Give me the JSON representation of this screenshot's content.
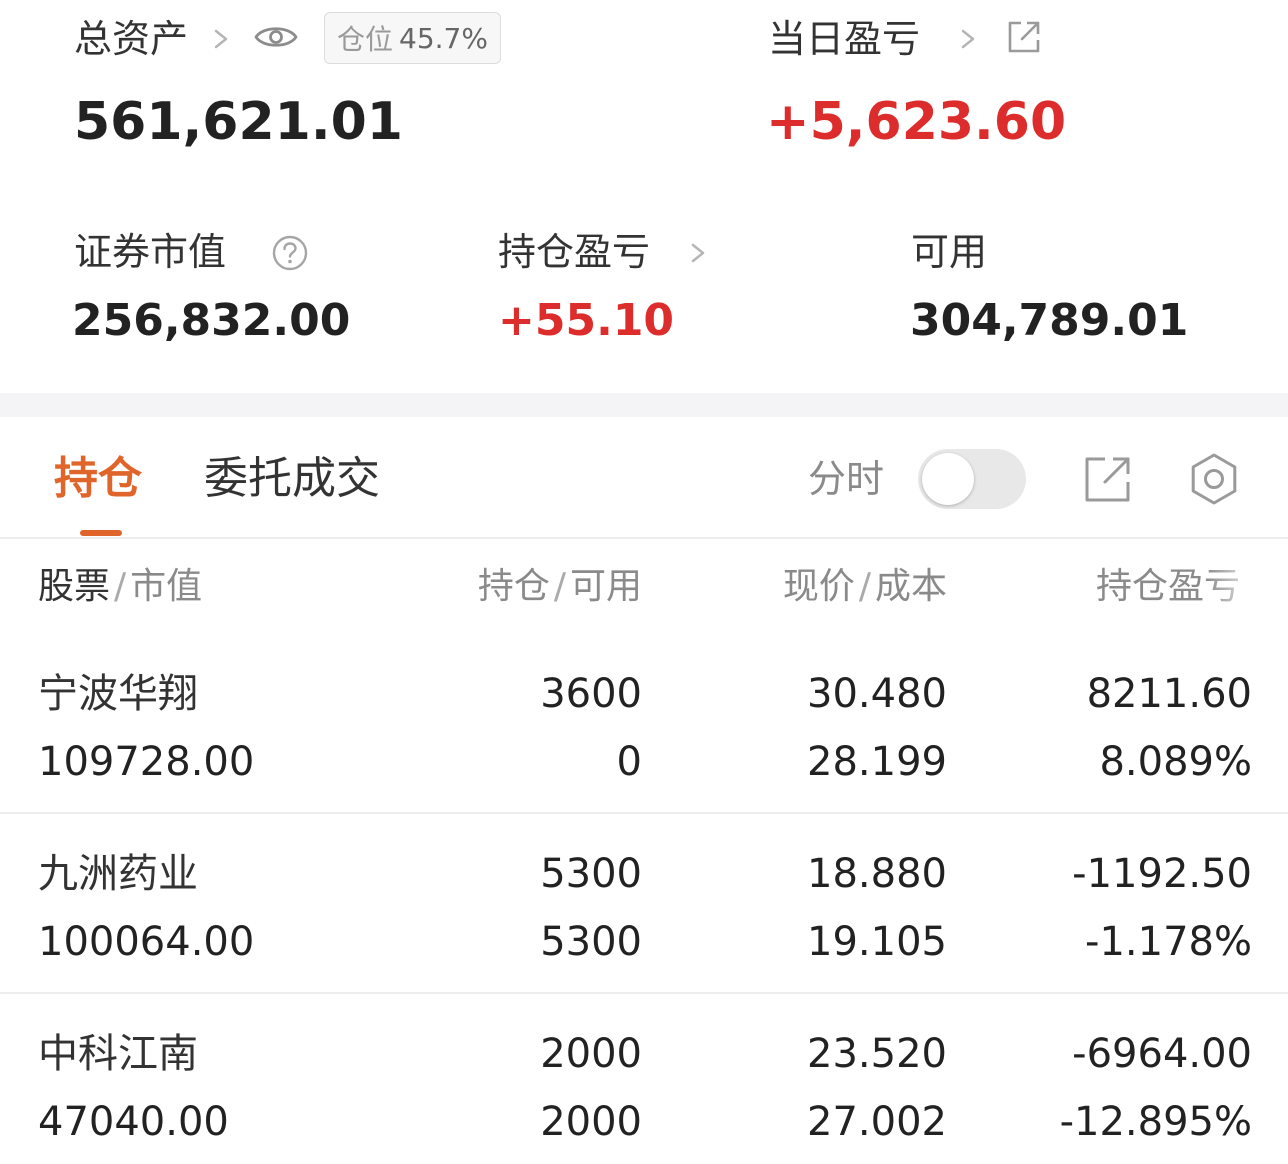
{
  "summary": {
    "total_assets_label": "总资产",
    "total_assets_value": "561,621.01",
    "position_label": "仓位",
    "position_value": "45.7%",
    "daily_pnl_label": "当日盈亏",
    "daily_pnl_value": "+5,623.60",
    "market_value_label": "证券市值",
    "market_value_value": "256,832.00",
    "holding_pnl_label": "持仓盈亏",
    "holding_pnl_value": "+55.10",
    "available_label": "可用",
    "available_value": "304,789.01"
  },
  "tabs": {
    "holdings": "持仓",
    "orders": "委托成交"
  },
  "toolbar": {
    "timeshare_label": "分时",
    "timeshare_on": false
  },
  "table": {
    "headers": {
      "stock": "股票",
      "market_value": "市值",
      "position": "持仓",
      "available": "可用",
      "price": "现价",
      "cost": "成本",
      "pnl": "持仓盈亏"
    },
    "rows": [
      {
        "name": "宁波华翔",
        "market_value": "109728.00",
        "position": "3600",
        "available": "0",
        "price": "30.480",
        "cost": "28.199",
        "pnl": "8211.60",
        "pnl_pct": "8.089%",
        "direction": "up"
      },
      {
        "name": "九洲药业",
        "market_value": "100064.00",
        "position": "5300",
        "available": "5300",
        "price": "18.880",
        "cost": "19.105",
        "pnl": "-1192.50",
        "pnl_pct": "-1.178%",
        "direction": "down"
      },
      {
        "name": "中科江南",
        "market_value": "47040.00",
        "position": "2000",
        "available": "2000",
        "price": "23.520",
        "cost": "27.002",
        "pnl": "-6964.00",
        "pnl_pct": "-12.895%",
        "direction": "down"
      }
    ]
  },
  "colors": {
    "accent": "#e0652a",
    "gain": "#dd2c2c",
    "loss": "#3d9a3d"
  }
}
